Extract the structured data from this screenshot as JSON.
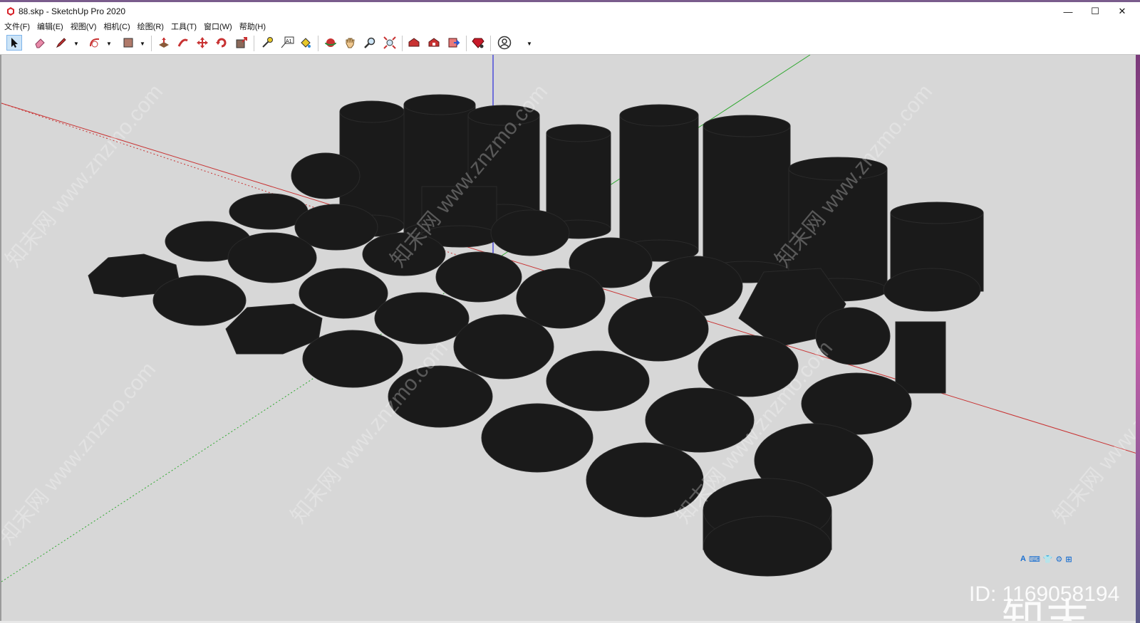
{
  "window": {
    "title": "88.skp - SketchUp Pro 2020",
    "minimize": "—",
    "maximize": "☐",
    "close": "✕"
  },
  "menu": [
    "文件(F)",
    "编辑(E)",
    "视图(V)",
    "相机(C)",
    "绘图(R)",
    "工具(T)",
    "窗口(W)",
    "帮助(H)"
  ],
  "toolbar": {
    "tools": [
      "select-tool",
      "eraser-tool",
      "pencil-tool",
      "arc-tool",
      "paint-bucket-tool",
      "push-pull-tool",
      "follow-me-tool",
      "move-tool",
      "rotate-tool",
      "scale-tool",
      "tape-measure-tool",
      "text-tool",
      "paint-tool",
      "orbit-tool",
      "pan-tool",
      "zoom-tool",
      "zoom-extents-tool",
      "3d-warehouse-tool",
      "extension-warehouse-tool",
      "send-to-layout-tool",
      "ruby-tool",
      "account-tool"
    ],
    "text_tool_label": "A1"
  },
  "watermark": {
    "text": "知末网 www.znzmo.com",
    "logo": "知末",
    "id": "ID: 1169058194"
  },
  "ime": [
    "A",
    "⌨",
    "👕",
    "⚙",
    "⊞"
  ],
  "colors": {
    "viewport_bg": "#d7d7d7",
    "model_fill": "#1a1a1a",
    "axis_red": "#c83232",
    "axis_green": "#2fa82f",
    "axis_blue": "#2a2ad8"
  }
}
